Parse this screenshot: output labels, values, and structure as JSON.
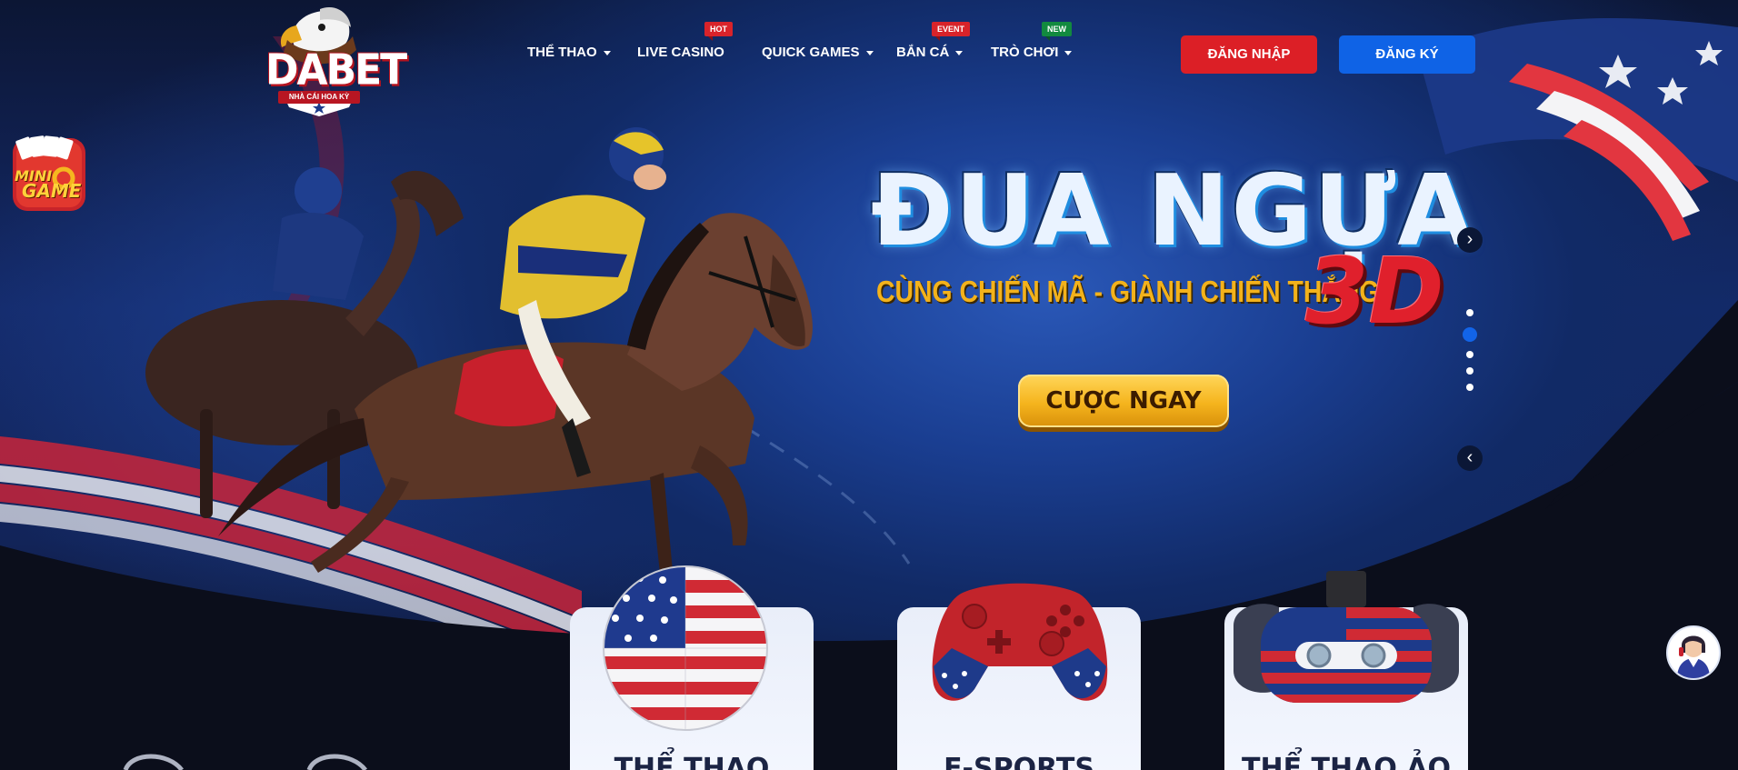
{
  "brand": {
    "name": "DABET",
    "tagline": "NHÀ CÁI HOA KỲ"
  },
  "nav": {
    "items": [
      {
        "label": "THỂ THAO",
        "has_dropdown": true,
        "badge": ""
      },
      {
        "label": "LIVE CASINO",
        "has_dropdown": false,
        "badge": "HOT"
      },
      {
        "label": "QUICK GAMES",
        "has_dropdown": true,
        "badge": ""
      },
      {
        "label": "BẮN CÁ",
        "has_dropdown": true,
        "badge": "EVENT"
      },
      {
        "label": "TRÒ CHƠI",
        "has_dropdown": true,
        "badge": "NEW"
      }
    ]
  },
  "auth": {
    "login_label": "ĐĂNG NHẬP",
    "register_label": "ĐĂNG KÝ"
  },
  "minigame": {
    "label_line1": "MINI",
    "label_line2": "GAME"
  },
  "banner": {
    "title": "ĐUA NGỰA",
    "subtitle": "CÙNG CHIẾN MÃ - GIÀNH CHIẾN THẮNG",
    "badge": "3D",
    "cta_label": "CƯỢC NGAY",
    "slide_count": 5,
    "active_slide": 2
  },
  "categories": [
    {
      "label": "THỂ THAO",
      "icon": "soccer-ball-usa-flag-icon"
    },
    {
      "label": "E-SPORTS",
      "icon": "gamepad-usa-flag-icon"
    },
    {
      "label": "THỂ THAO ẢO",
      "icon": "vr-headset-usa-flag-icon"
    }
  ],
  "colors": {
    "login": "#dc1f26",
    "register": "#0f63e6",
    "accent_gold": "#f3b21b",
    "badge_red": "#d8232a",
    "badge_green": "#128a3f",
    "dot_active": "#1264e8"
  }
}
